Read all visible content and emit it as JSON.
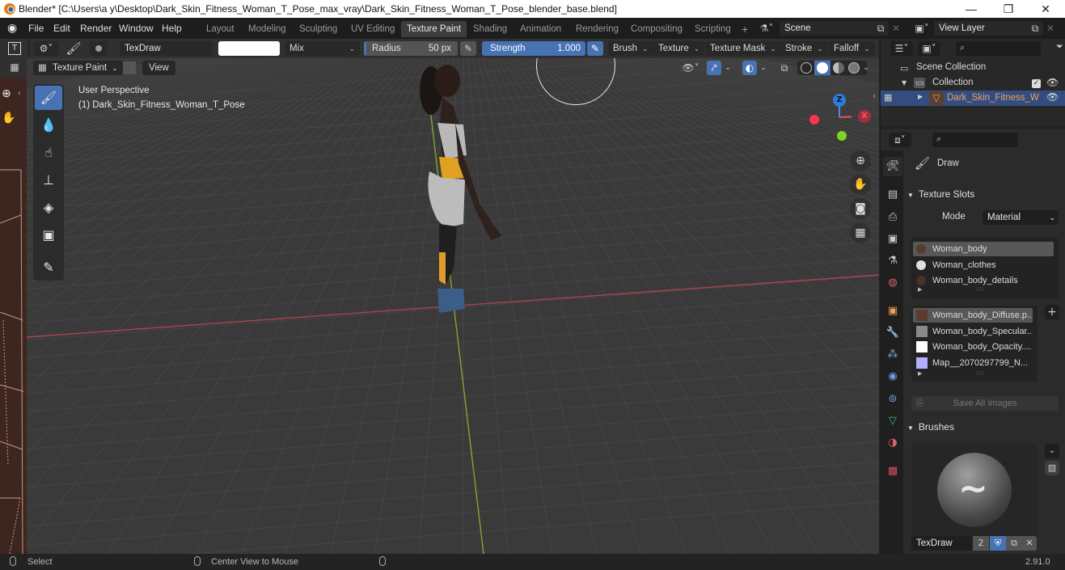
{
  "titlebar": {
    "title": "Blender* [C:\\Users\\a y\\Desktop\\Dark_Skin_Fitness_Woman_T_Pose_max_vray\\Dark_Skin_Fitness_Woman_T_Pose_blender_base.blend]",
    "minimize": "—",
    "maximize": "❐",
    "close": "✕"
  },
  "menu": [
    "File",
    "Edit",
    "Render",
    "Window",
    "Help"
  ],
  "workspaces": [
    {
      "label": "Layout",
      "active": false
    },
    {
      "label": "Modeling",
      "active": false
    },
    {
      "label": "Sculpting",
      "active": false
    },
    {
      "label": "UV Editing",
      "active": false
    },
    {
      "label": "Texture Paint",
      "active": true
    },
    {
      "label": "Shading",
      "active": false
    },
    {
      "label": "Animation",
      "active": false
    },
    {
      "label": "Rendering",
      "active": false
    },
    {
      "label": "Compositing",
      "active": false
    },
    {
      "label": "Scripting",
      "active": false
    }
  ],
  "add_workspace": "+",
  "scene": {
    "label": "Scene",
    "icon": "scene-icon"
  },
  "view_layer": {
    "label": "View Layer",
    "icon": "view-layer-icon"
  },
  "tool_header": {
    "brush_name": "TexDraw",
    "color": "#ffffff",
    "blend_mode": "Mix",
    "radius_label": "Radius",
    "radius_value": "50 px",
    "strength_label": "Strength",
    "strength_value": "1.000",
    "strength_fraction": 1.0,
    "menus": [
      "Brush",
      "Texture",
      "Texture Mask",
      "Stroke",
      "Falloff"
    ]
  },
  "viewport_header": {
    "mode": "Texture Paint",
    "view": "View"
  },
  "viewport": {
    "perspective": "User Perspective",
    "object": "(1) Dark_Skin_Fitness_Woman_T_Pose",
    "gizmo": {
      "z": "Z",
      "x": "X"
    },
    "nav_buttons": [
      "zoom-icon",
      "pan-hand-icon",
      "camera-icon",
      "ortho-grid-icon"
    ]
  },
  "toolbar": [
    "draw-brush-icon",
    "soften-icon",
    "smear-icon",
    "clone-stamp-icon",
    "fill-bucket-icon",
    "mask-icon",
    "annotate-icon"
  ],
  "outliner": {
    "scene_collection": "Scene Collection",
    "collection": "Collection",
    "object": "Dark_Skin_Fitness_W",
    "collection_checked": true
  },
  "properties": {
    "active_tool": "Draw",
    "texture_slots": {
      "title": "Texture Slots",
      "mode_label": "Mode",
      "mode_value": "Material",
      "materials": [
        {
          "name": "Woman_body",
          "selected": true,
          "color": "#5a3a2e"
        },
        {
          "name": "Woman_clothes",
          "selected": false,
          "color": "#e0e0e0"
        },
        {
          "name": "Woman_body_details",
          "selected": false,
          "color": "#4a3027"
        }
      ],
      "images": [
        {
          "name": "Woman_body_Diffuse.p...",
          "selected": true,
          "color": "#5b3b30"
        },
        {
          "name": "Woman_body_Specular...",
          "selected": false,
          "color": "#8a8a8a"
        },
        {
          "name": "Woman_body_Opacity....",
          "selected": false,
          "color": "#ffffff"
        },
        {
          "name": "Map__2070297799_N...",
          "selected": false,
          "color": "#b0b0ff"
        }
      ],
      "save_all": "Save All Images"
    },
    "brushes": {
      "title": "Brushes",
      "name": "TexDraw",
      "users": "2"
    }
  },
  "statusbar": {
    "left": "Select",
    "middle": "Center View to Mouse",
    "version": "2.91.0"
  }
}
